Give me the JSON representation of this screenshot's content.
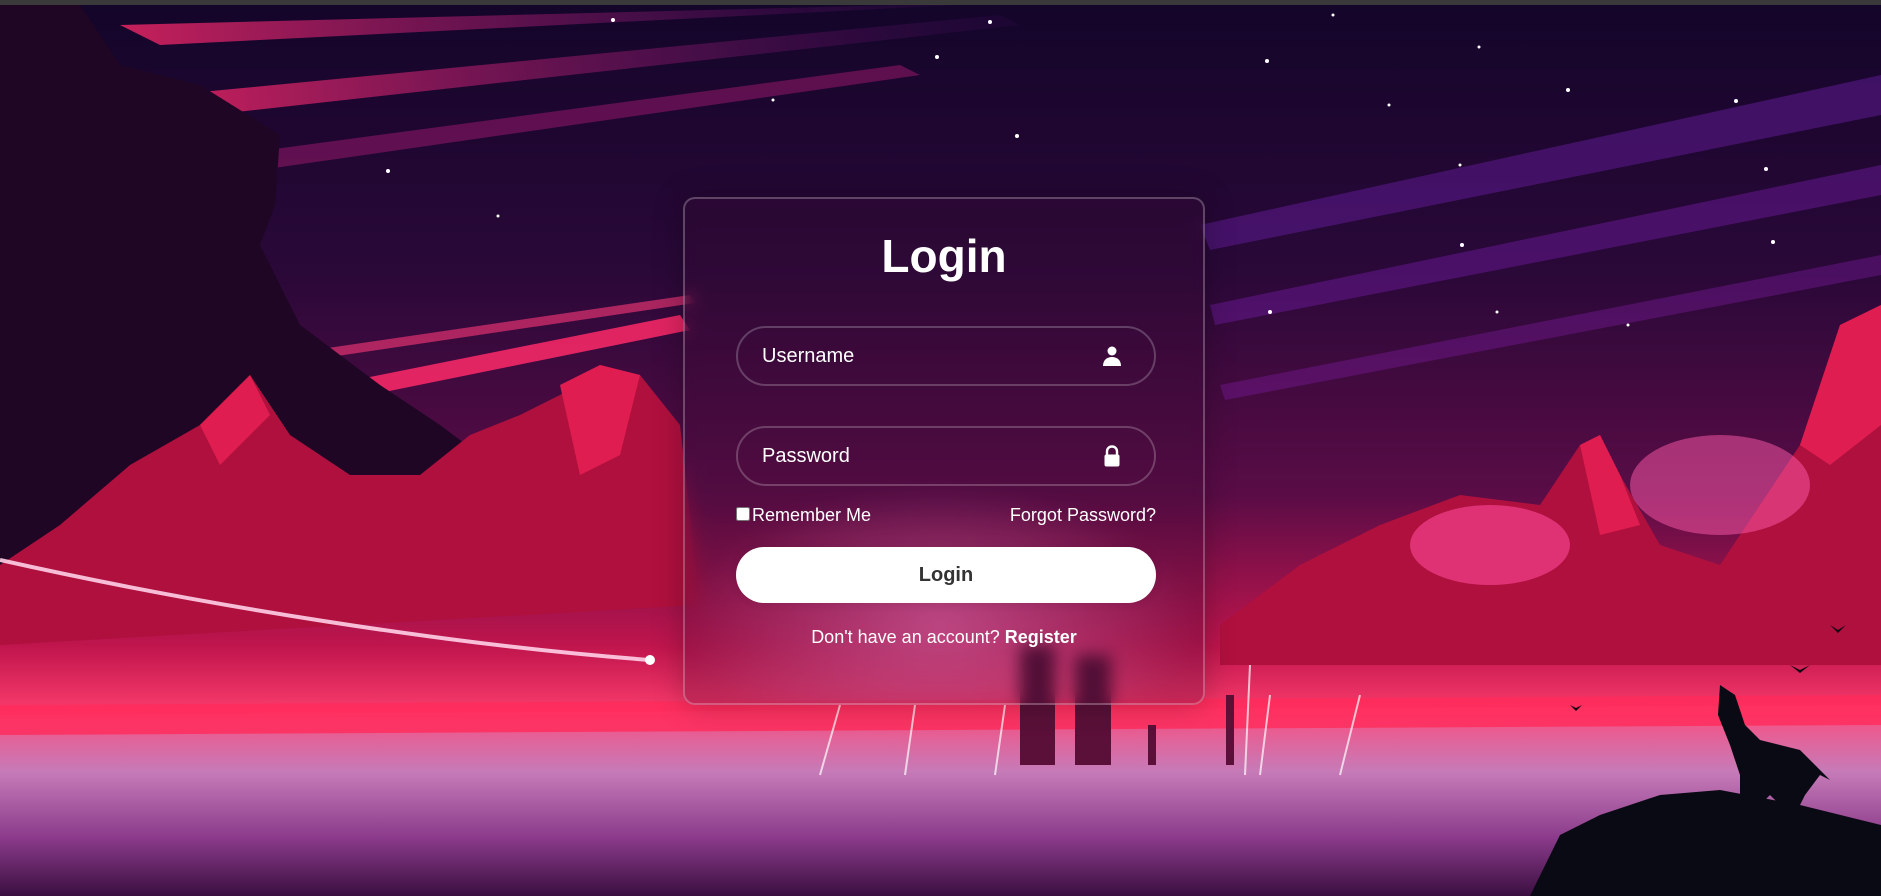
{
  "form": {
    "title": "Login",
    "username_placeholder": "Username",
    "password_placeholder": "Password",
    "remember_label": "Remember Me",
    "forgot_label": "Forgot Password?",
    "login_button": "Login",
    "register_prompt": "Don't have an account?",
    "register_link": "Register"
  },
  "icons": {
    "username": "user-icon",
    "password": "lock-icon"
  },
  "colors": {
    "sky_top": "#14052a",
    "sky_mid": "#3a0a3e",
    "horizon": "#e0155a",
    "mountain": "#b0103e",
    "button_bg": "#ffffff",
    "button_text": "#333333"
  }
}
